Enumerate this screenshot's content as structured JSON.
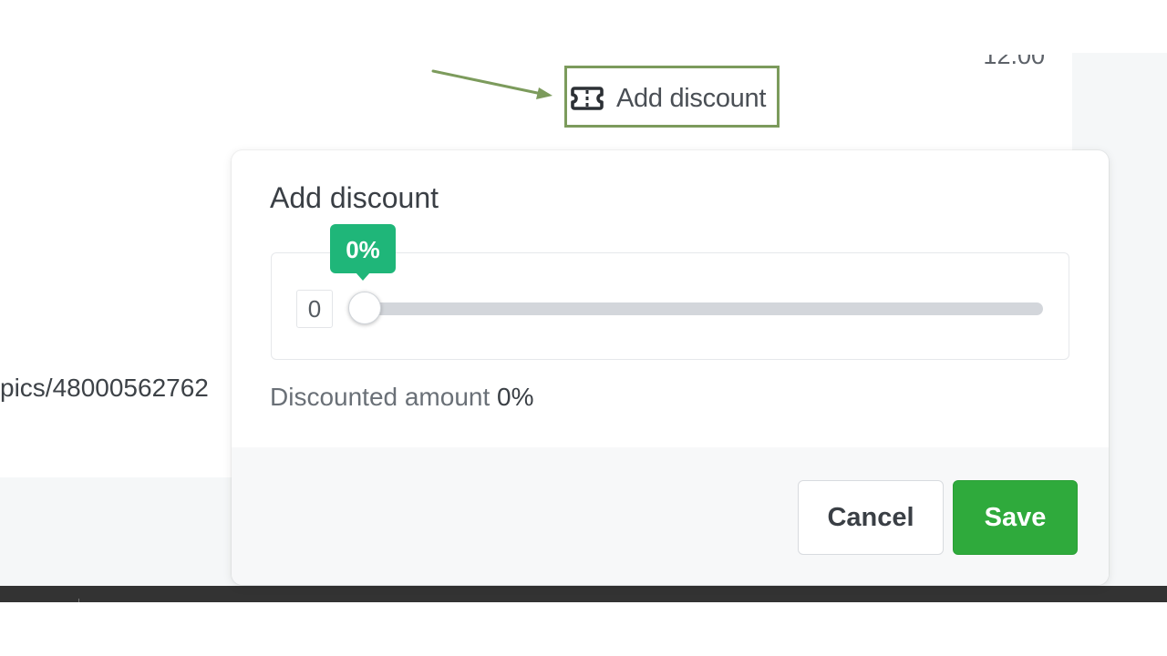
{
  "background": {
    "price_partial": "12.00",
    "url_fragment": "pics/48000562762"
  },
  "add_discount_link": {
    "label": "Add discount",
    "icon": "ticket-icon"
  },
  "modal": {
    "title": "Add discount",
    "slider": {
      "value": "0",
      "tooltip": "0%",
      "min": 0,
      "max": 100,
      "current_percent": 0
    },
    "discounted_amount_label": "Discounted amount",
    "discounted_amount_value": "0%",
    "cancel_label": "Cancel",
    "save_label": "Save"
  },
  "colors": {
    "accent_green": "#2faa3c",
    "tooltip_green": "#1fb679",
    "annotation_green": "#7c9b5c"
  }
}
